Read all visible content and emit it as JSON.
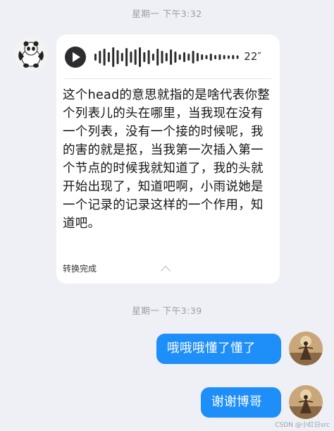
{
  "chat": {
    "timestamp_1": "星期一 下午3:32",
    "timestamp_2": "星期一 下午3:39",
    "voice_message": {
      "duration": "22″",
      "transcript": "这个head的意思就指的是啥代表你整个列表儿的头在哪里，当我现在没有一个列表，没有一个接的时候呢，我的害的就是抠，当我第一次插入第一个节点的时候我就知道了，我的头就开始出现了，知道吧啊，小雨说她是一个记录的记录这样的一个作用，知道吧。",
      "status": "转换完成"
    },
    "reply_1": "哦哦哦懂了懂了",
    "reply_2": "谢谢博哥"
  },
  "watermark": "CSDN @小红日src",
  "icons": {
    "left_avatar": "panda-avatar",
    "right_avatar": "landscape-figure-avatar",
    "play": "play-icon",
    "collapse": "chevron-up-icon"
  },
  "colors": {
    "background": "#eef0f6",
    "sent_bubble": "#1e8ef9",
    "received_bubble": "#ffffff"
  }
}
